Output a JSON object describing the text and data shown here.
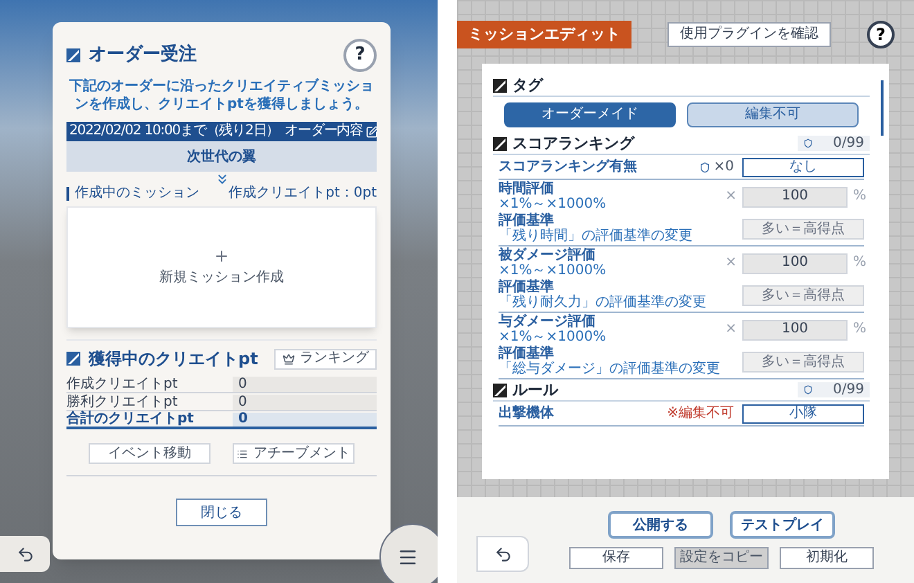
{
  "order_screen": {
    "title": "オーダー受注",
    "help": "?",
    "description": "下記のオーダーに沿ったクリエイティブミッションを作成し、クリエイトptを獲得しましょう。",
    "deadline": "2022/02/02 10:00まで（残り2日）",
    "order_details_button": "オーダー内容",
    "order_name": "次世代の翼",
    "current_mission_label": "作成中のミッション",
    "create_pt": "作成クリエイトpt：0pt",
    "new_mission": "新規ミッション作成",
    "pt_section": {
      "title": "獲得中のクリエイトpt",
      "ranking_button": "ランキング",
      "rows": [
        {
          "label": "作成クリエイトpt",
          "value": "0",
          "total": false
        },
        {
          "label": "勝利クリエイトpt",
          "value": "0",
          "total": false
        },
        {
          "label": "合計のクリエイトpt",
          "value": "0",
          "total": true
        }
      ]
    },
    "buttons": [
      {
        "label": "イベント移動",
        "kind": "plain"
      },
      {
        "label": "アチーブメント",
        "kind": "list"
      }
    ],
    "close_button": "閉じる"
  },
  "edit_screen": {
    "title": "ミッションエディット",
    "plugin_button": "使用プラグインを確認",
    "help": "?",
    "sections": [
      {
        "kind": "tags",
        "title": "タグ",
        "tags": [
          {
            "label": "オーダーメイド",
            "selected": true
          },
          {
            "label": "編集不可",
            "selected": false
          }
        ]
      },
      {
        "kind": "settings",
        "title": "スコアランキング",
        "count": "0/99",
        "rows": [
          {
            "kind": "choice",
            "label": "スコアランキング有無",
            "count": "×0",
            "value": "なし"
          },
          {
            "kind": "percent",
            "label": "時間評価",
            "sub": "×1%～×1000%",
            "prefix": "×",
            "value": "100",
            "unit": "%"
          },
          {
            "kind": "criterion",
            "label": "評価基準",
            "sub": "「残り時間」の評価基準の変更",
            "value": "多い＝高得点"
          },
          {
            "kind": "percent",
            "label": "被ダメージ評価",
            "sub": "×1%～×1000%",
            "prefix": "×",
            "value": "100",
            "unit": "%"
          },
          {
            "kind": "criterion",
            "label": "評価基準",
            "sub": "「残り耐久力」の評価基準の変更",
            "value": "多い＝高得点"
          },
          {
            "kind": "percent",
            "label": "与ダメージ評価",
            "sub": "×1%～×1000%",
            "prefix": "×",
            "value": "100",
            "unit": "%"
          },
          {
            "kind": "criterion",
            "label": "評価基準",
            "sub": "「総与ダメージ」の評価基準の変更",
            "value": "多い＝高得点"
          }
        ]
      },
      {
        "kind": "settings",
        "title": "ルール",
        "count": "0/99",
        "rows": [
          {
            "kind": "choice",
            "label": "出撃機体",
            "note": "※編集不可",
            "value": "小隊"
          }
        ]
      }
    ]
  },
  "footer": {
    "publish_button": "公開する",
    "test_play_button": "テストプレイ",
    "actions": [
      {
        "label": "保存",
        "disabled": false
      },
      {
        "label": "設定をコピー",
        "disabled": true
      },
      {
        "label": "初期化",
        "disabled": false
      }
    ]
  }
}
